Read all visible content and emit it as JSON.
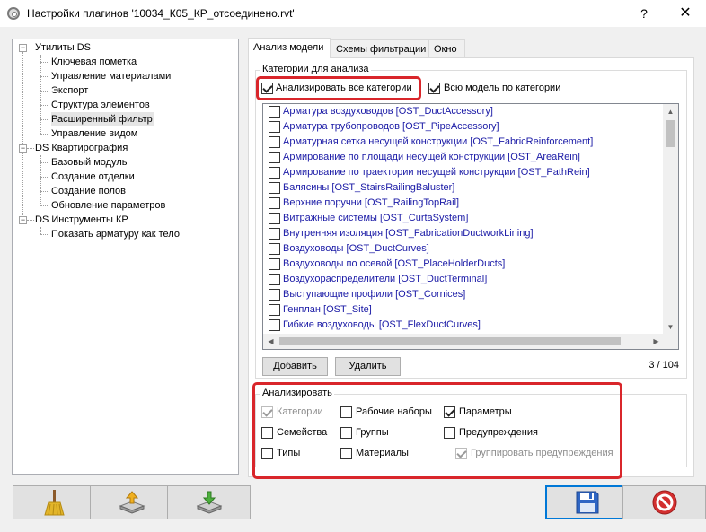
{
  "window": {
    "title": "Настройки плагинов '10034_К05_КР_отсоединено.rvt'",
    "help": "?",
    "close": "✕"
  },
  "tree": {
    "groups": [
      {
        "label": "Утилиты DS",
        "children": [
          "Ключевая пометка",
          "Управление материалами",
          "Экспорт",
          "Структура элементов",
          "Расширенный фильтр",
          "Управление видом"
        ]
      },
      {
        "label": "DS Квартирография",
        "children": [
          "Базовый модуль",
          "Создание отделки",
          "Создание полов",
          "Обновление параметров"
        ]
      },
      {
        "label": "DS Инструменты КР",
        "children": [
          "Показать арматуру как тело"
        ]
      }
    ],
    "selected": "Расширенный фильтр"
  },
  "tabs": [
    "Анализ модели",
    "Схемы фильтрации",
    "Окно"
  ],
  "categories_group": {
    "title": "Категории для анализа",
    "analyze_all": {
      "label": "Анализировать все категории",
      "checked": true
    },
    "whole_model": {
      "label": "Всю модель по категории",
      "checked": true
    },
    "items": [
      "Арматура воздуховодов [OST_DuctAccessory]",
      "Арматура трубопроводов [OST_PipeAccessory]",
      "Арматурная сетка несущей конструкции [OST_FabricReinforcement]",
      "Армирование по площади несущей конструкции [OST_AreaRein]",
      "Армирование по траектории несущей конструкции [OST_PathRein]",
      "Балясины [OST_StairsRailingBaluster]",
      "Верхние поручни [OST_RailingTopRail]",
      "Витражные системы [OST_CurtaSystem]",
      "Внутренняя изоляция [OST_FabricationDuctworkLining]",
      "Воздуховоды [OST_DuctCurves]",
      "Воздуховоды по осевой [OST_PlaceHolderDucts]",
      "Воздухораспределители [OST_DuctTerminal]",
      "Выступающие профили [OST_Cornices]",
      "Генплан [OST_Site]",
      "Гибкие воздуховоды [OST_FlexDuctCurves]"
    ],
    "add_label": "Добавить",
    "remove_label": "Удалить",
    "counter": "3 / 104"
  },
  "analyze_group": {
    "title": "Анализировать",
    "options": [
      {
        "label": "Категории",
        "checked": true,
        "disabled": true
      },
      {
        "label": "Рабочие наборы",
        "checked": false,
        "disabled": false
      },
      {
        "label": "Параметры",
        "checked": true,
        "disabled": false
      },
      {
        "label": "Семейства",
        "checked": false,
        "disabled": false
      },
      {
        "label": "Группы",
        "checked": false,
        "disabled": false
      },
      {
        "label": "Предупреждения",
        "checked": false,
        "disabled": false
      },
      {
        "label": "Типы",
        "checked": false,
        "disabled": false
      },
      {
        "label": "Материалы",
        "checked": false,
        "disabled": false
      },
      {
        "label": "Группировать предупреждения",
        "checked": true,
        "disabled": true
      }
    ]
  },
  "bottom_buttons": [
    "broom-icon",
    "import-icon",
    "export-icon",
    "save-icon",
    "cancel-icon"
  ],
  "colors": {
    "highlight": "#d9262b",
    "item_text": "#1a1aa6",
    "accent": "#0078d7"
  }
}
